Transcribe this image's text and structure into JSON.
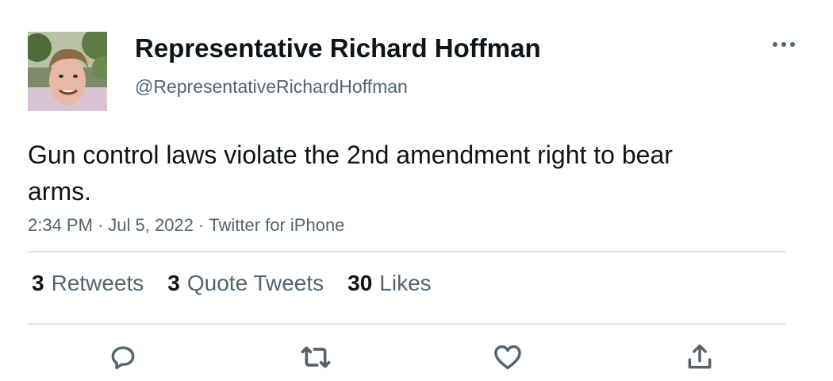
{
  "author": {
    "display_name": "Representative Richard Hoffman",
    "handle": "@RepresentativeRichardHoffman",
    "avatar_icon": "profile-photo"
  },
  "tweet": {
    "text": "Gun control laws violate the 2nd amendment right to bear arms.",
    "time": "2:34 PM",
    "date": "Jul 5, 2022",
    "source": "Twitter for iPhone",
    "separator": "·"
  },
  "stats": {
    "retweets": {
      "count": "3",
      "label": "Retweets"
    },
    "quote_tweets": {
      "count": "3",
      "label": "Quote Tweets"
    },
    "likes": {
      "count": "30",
      "label": "Likes"
    }
  },
  "actions": {
    "reply_icon": "reply-icon",
    "retweet_icon": "retweet-icon",
    "like_icon": "heart-icon",
    "share_icon": "share-icon",
    "more_icon": "more-horizontal-icon"
  },
  "colors": {
    "text_primary": "#0f1419",
    "text_secondary": "#536471",
    "divider": "#e1e4e8"
  }
}
